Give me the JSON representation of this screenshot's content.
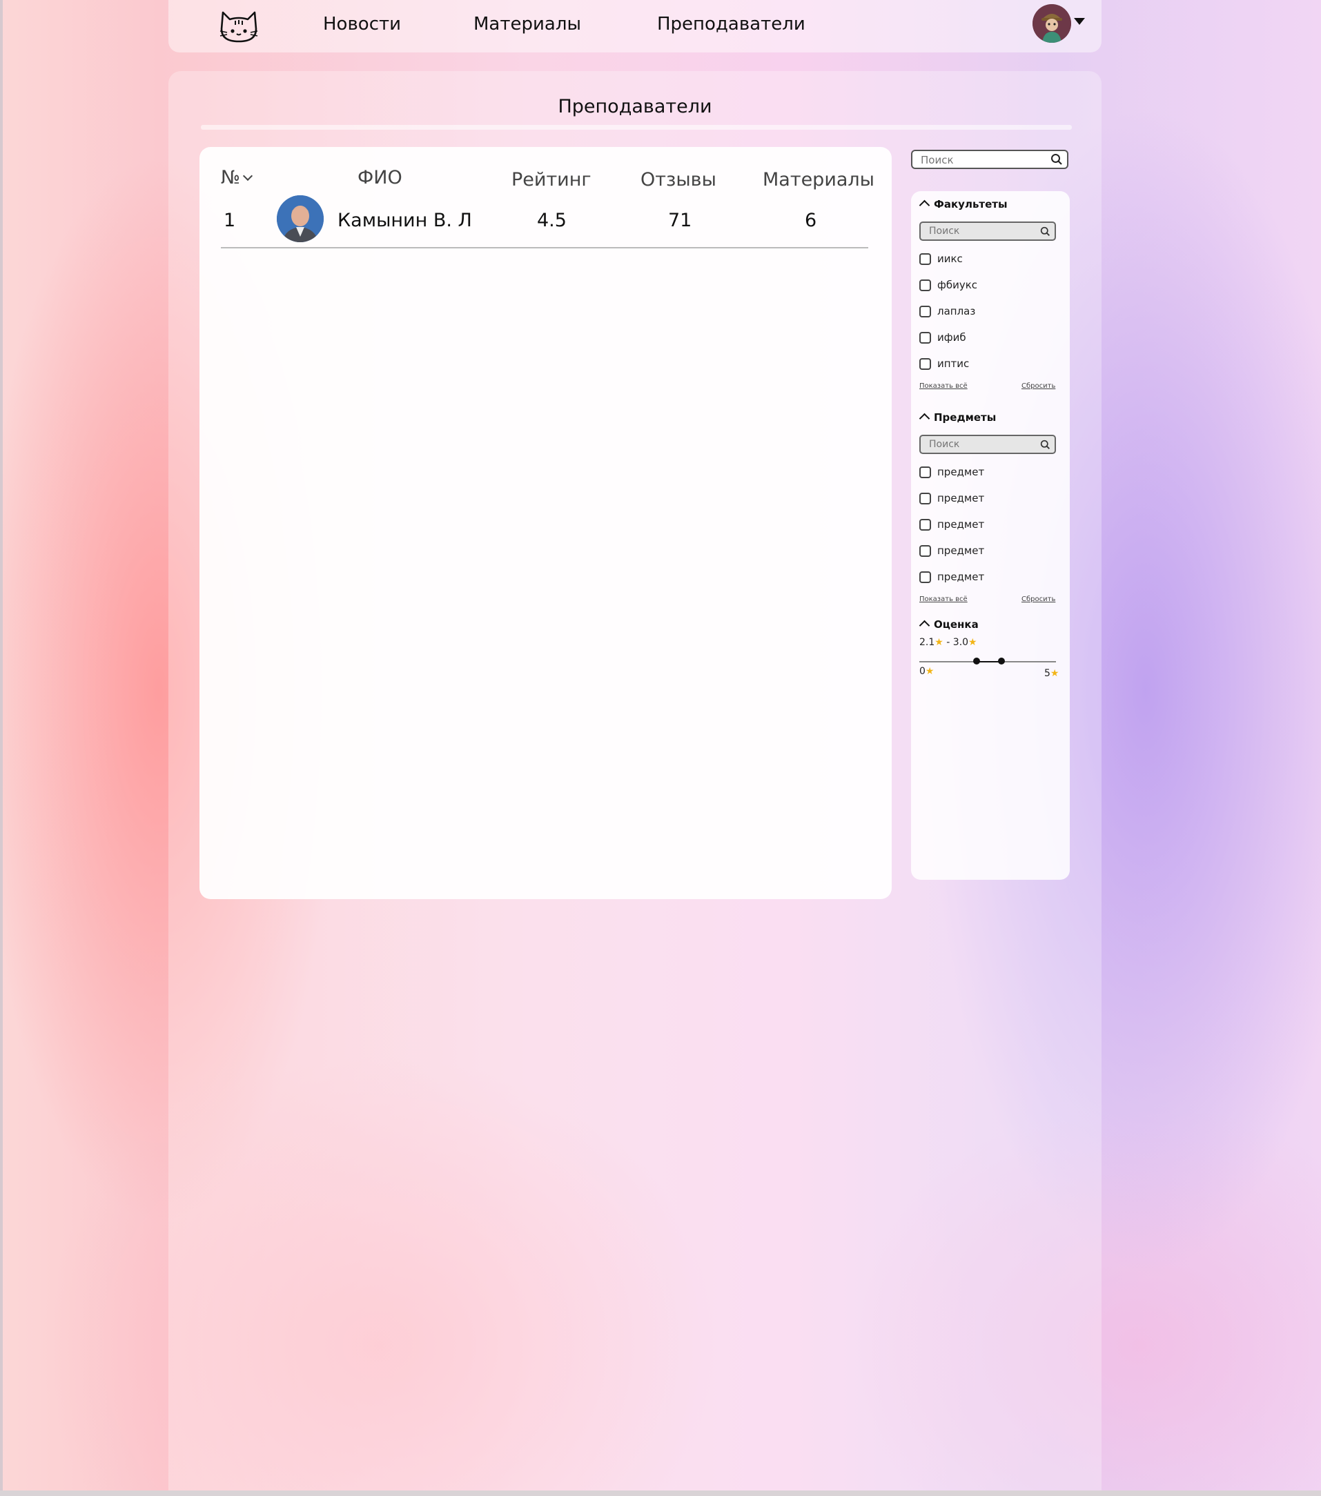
{
  "nav": {
    "links": [
      "Новости",
      "Материалы",
      "Преподаватели"
    ]
  },
  "page": {
    "title": "Преподаватели"
  },
  "table": {
    "headers": {
      "num": "№",
      "fio": "ФИО",
      "rating": "Рейтинг",
      "reviews": "Отзывы",
      "materials": "Материалы"
    },
    "rows": [
      {
        "num": "1",
        "name": "Камынин В. Л",
        "rating": "4.5",
        "reviews": "71",
        "materials": "6"
      }
    ]
  },
  "search": {
    "placeholder": "Поиск"
  },
  "filters": {
    "faculties": {
      "title": "Факультеты",
      "search_placeholder": "Поиск",
      "options": [
        "иикс",
        "фбиукс",
        "лаплаз",
        "ифиб",
        "иптис"
      ],
      "show_all": "Показать всё",
      "reset": "Сбросить"
    },
    "subjects": {
      "title": "Предметы",
      "search_placeholder": "Поиск",
      "options": [
        "предмет",
        "предмет",
        "предмет",
        "предмет",
        "предмет"
      ],
      "show_all": "Показать всё",
      "reset": "Сбросить"
    },
    "rating": {
      "title": "Оценка",
      "selected_min": "2.1",
      "selected_max": "3.0",
      "range_sep": " - ",
      "min_label": "0",
      "max_label": "5",
      "range_min": 0,
      "range_max": 5,
      "value_min": 2.1,
      "value_max": 3.0
    }
  },
  "colors": {
    "star": "#f2b517",
    "accent_text": "#111111"
  },
  "icons": {
    "logo": "cat-logo-icon",
    "search": "search-icon",
    "sort": "chevron-down-icon",
    "collapse": "chevron-up-icon",
    "dropdown": "caret-down-icon",
    "star": "star-icon"
  }
}
